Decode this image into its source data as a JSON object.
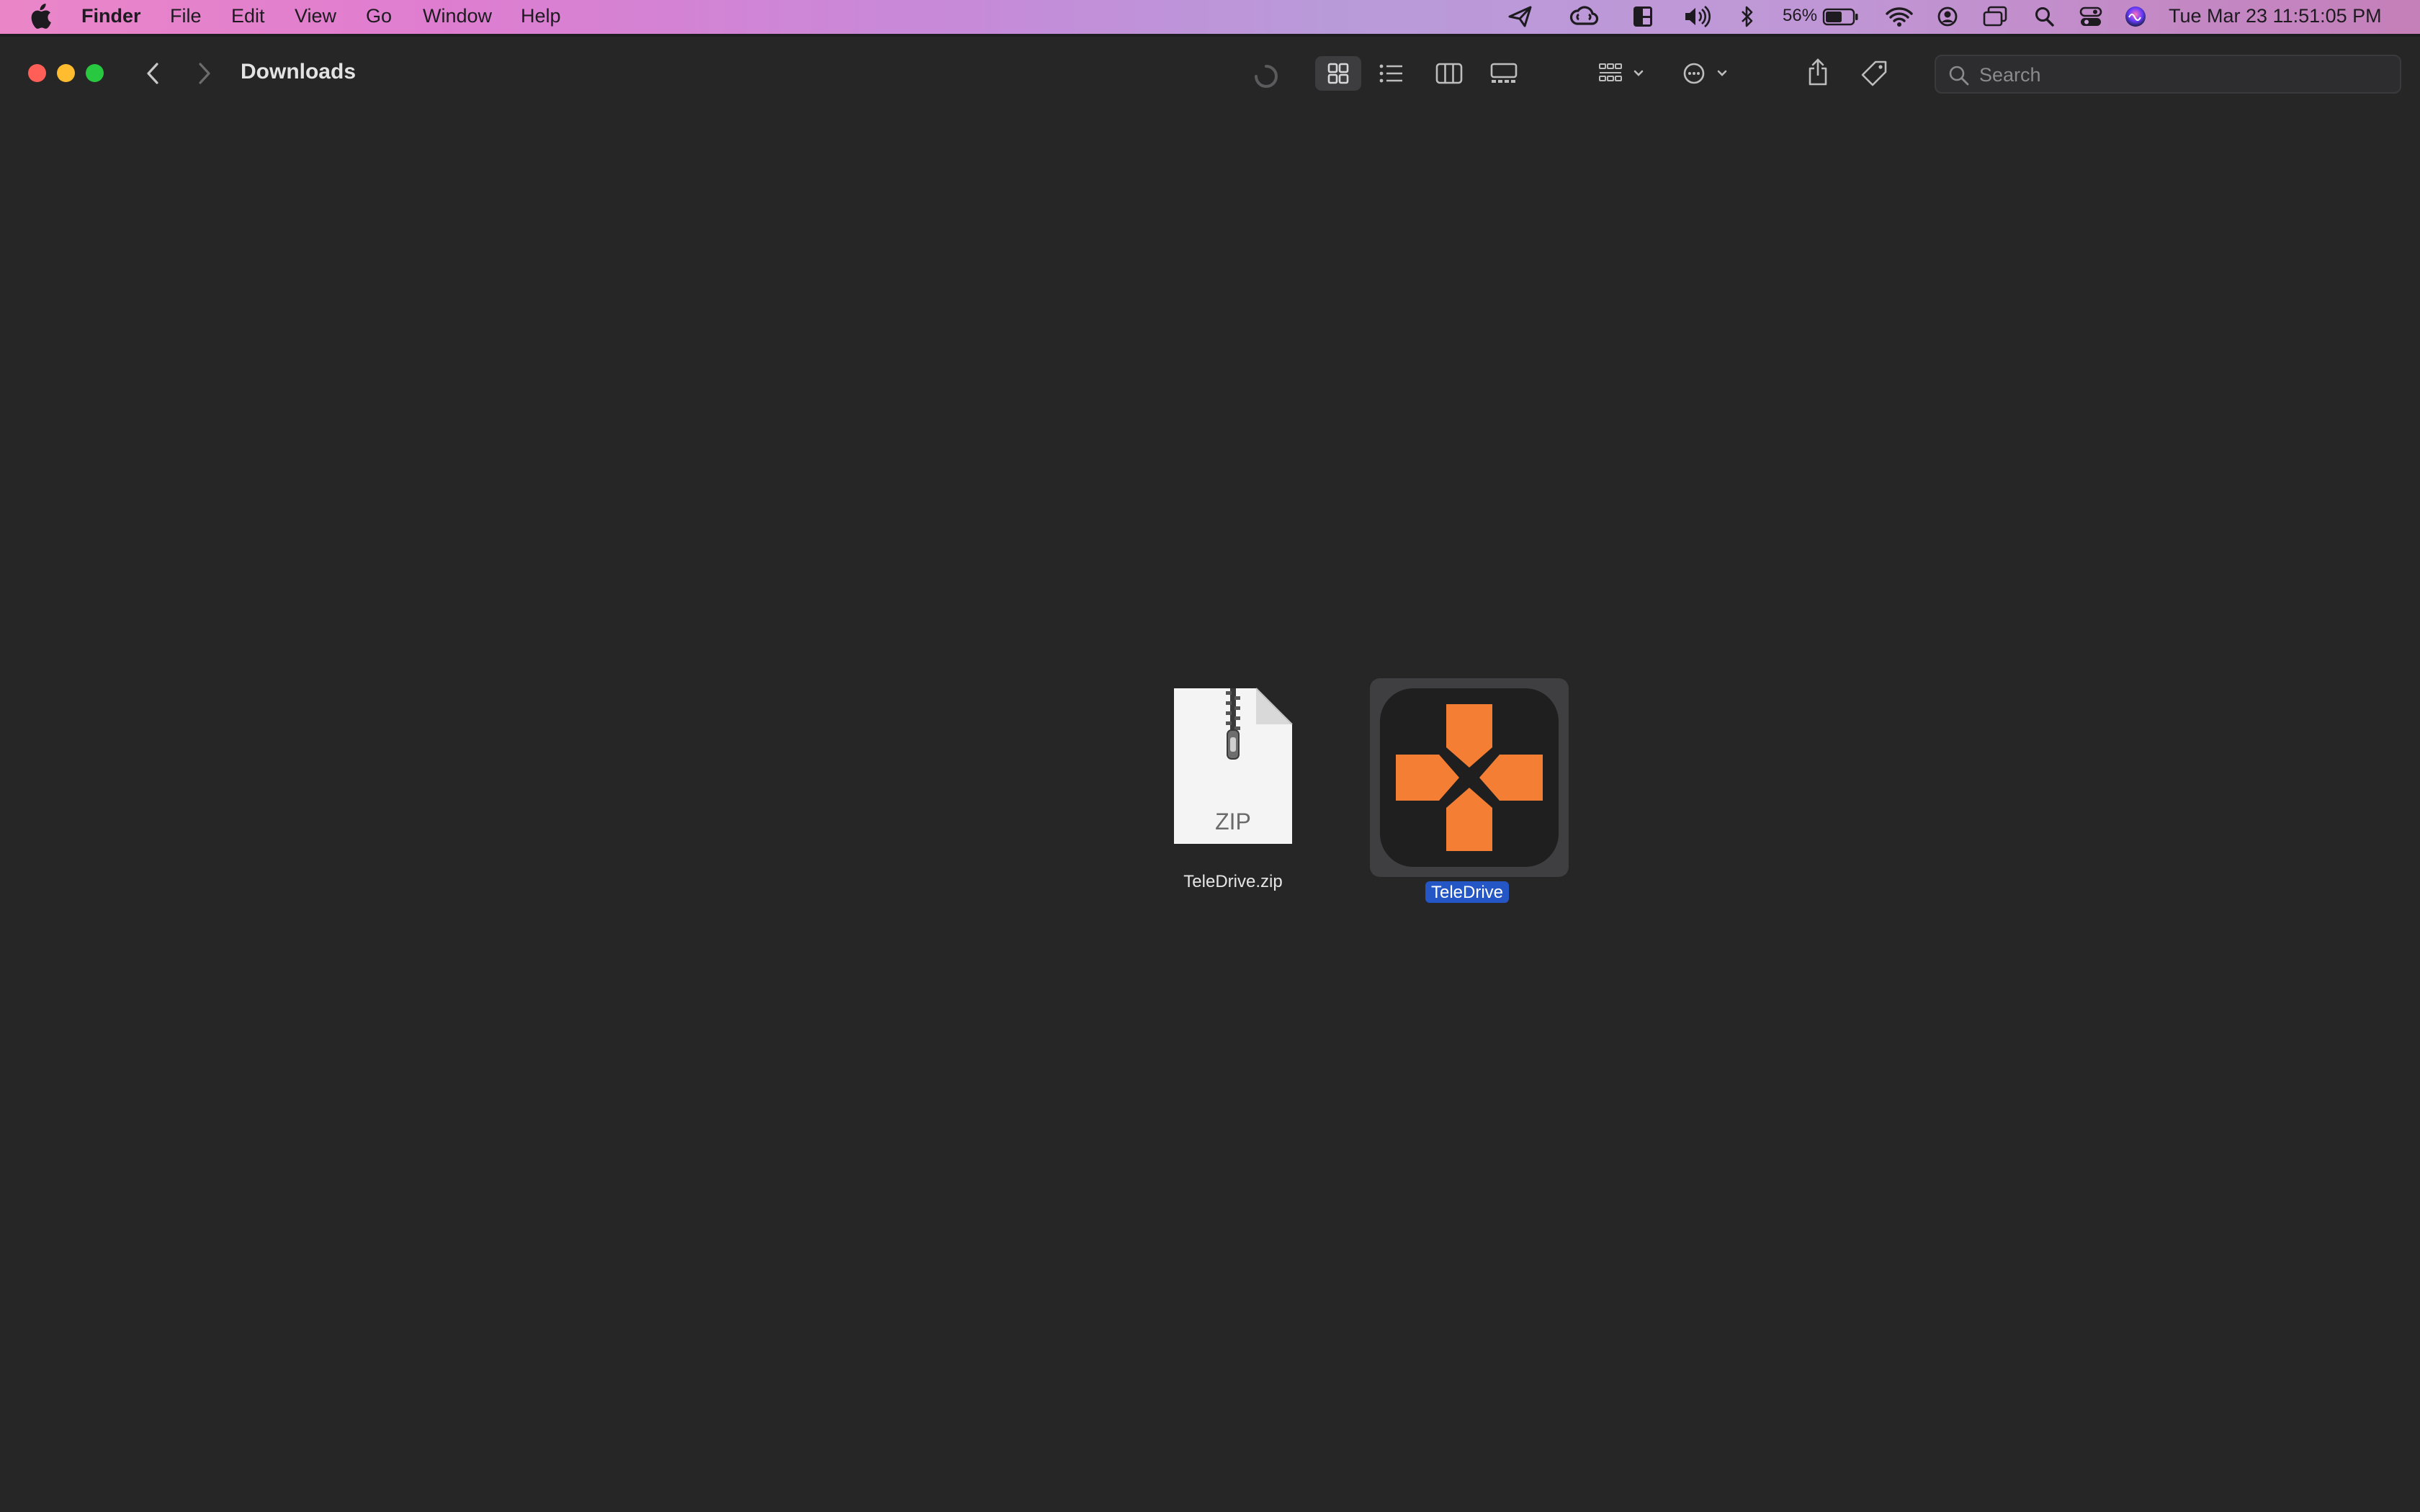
{
  "menubar": {
    "app_name": "Finder",
    "menus": [
      "File",
      "Edit",
      "View",
      "Go",
      "Window",
      "Help"
    ],
    "battery_percent": "56%",
    "clock": "Tue Mar 23  11:51:05 PM",
    "status_icons": [
      "send-icon",
      "creative-cloud-icon",
      "layout-icon",
      "volume-icon",
      "bluetooth-icon",
      "battery-icon",
      "wifi-icon",
      "user-icon",
      "screen-mirroring-icon",
      "spotlight-search-icon",
      "control-center-icon",
      "siri-icon"
    ]
  },
  "window": {
    "title": "Downloads",
    "search_placeholder": "Search",
    "toolbar_icons": [
      "back-icon",
      "forward-icon",
      "loading-spinner-icon",
      "icon-view-icon",
      "list-view-icon",
      "column-view-icon",
      "gallery-view-icon",
      "group-icon",
      "more-actions-icon",
      "share-icon",
      "tag-icon"
    ]
  },
  "files": [
    {
      "name": "TeleDrive.zip",
      "kind_label": "ZIP",
      "icon": "zip-file-icon",
      "selected": false
    },
    {
      "name": "TeleDrive",
      "icon": "teledrive-app-icon",
      "selected": true
    }
  ],
  "colors": {
    "window_bg": "#272627",
    "selection_label": "#2457c5",
    "app_orange": "#f47e33",
    "close": "#ff5f57",
    "minimize": "#febc2e",
    "zoom": "#28c840"
  }
}
